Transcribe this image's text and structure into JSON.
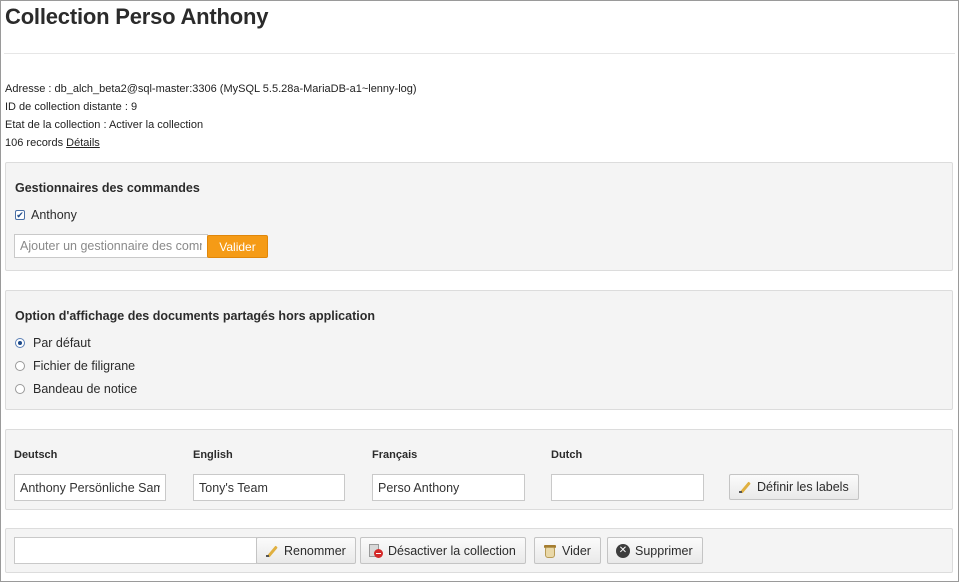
{
  "page_title": "Collection Perso Anthony",
  "info": {
    "address": "Adresse : db_alch_beta2@sql-master:3306 (MySQL 5.5.28a-MariaDB-a1~lenny-log)",
    "remote_id": "ID de collection distante : 9",
    "state": "Etat de la collection : Activer la collection",
    "records_text": "106 records",
    "details_link": "Détails"
  },
  "managers": {
    "title": "Gestionnaires des commandes",
    "users": [
      {
        "label": "Anthony",
        "checked": true
      }
    ],
    "add_input_placeholder": "Ajouter un gestionnaire des commandes",
    "submit_label": "Valider"
  },
  "display_option": {
    "title": "Option d'affichage des documents partagés hors application",
    "options": [
      {
        "label": "Par défaut",
        "selected": true
      },
      {
        "label": "Fichier de filigrane",
        "selected": false
      },
      {
        "label": "Bandeau de notice",
        "selected": false
      }
    ]
  },
  "labels": {
    "languages": [
      {
        "name": "Deutsch",
        "value": "Anthony Persönliche Sammlung"
      },
      {
        "name": "English",
        "value": "Tony's Team"
      },
      {
        "name": "Français",
        "value": "Perso Anthony"
      },
      {
        "name": "Dutch",
        "value": ""
      }
    ],
    "define_button": "Définir les labels"
  },
  "actions": {
    "rename_input_value": "",
    "rename_button": "Renommer",
    "deactivate_button": "Désactiver la collection",
    "empty_button": "Vider",
    "delete_button": "Supprimer"
  },
  "colors": {
    "accent_orange": "#f59b16",
    "panel_bg": "#f4f4f4",
    "delete_red": "#d42a2a"
  }
}
